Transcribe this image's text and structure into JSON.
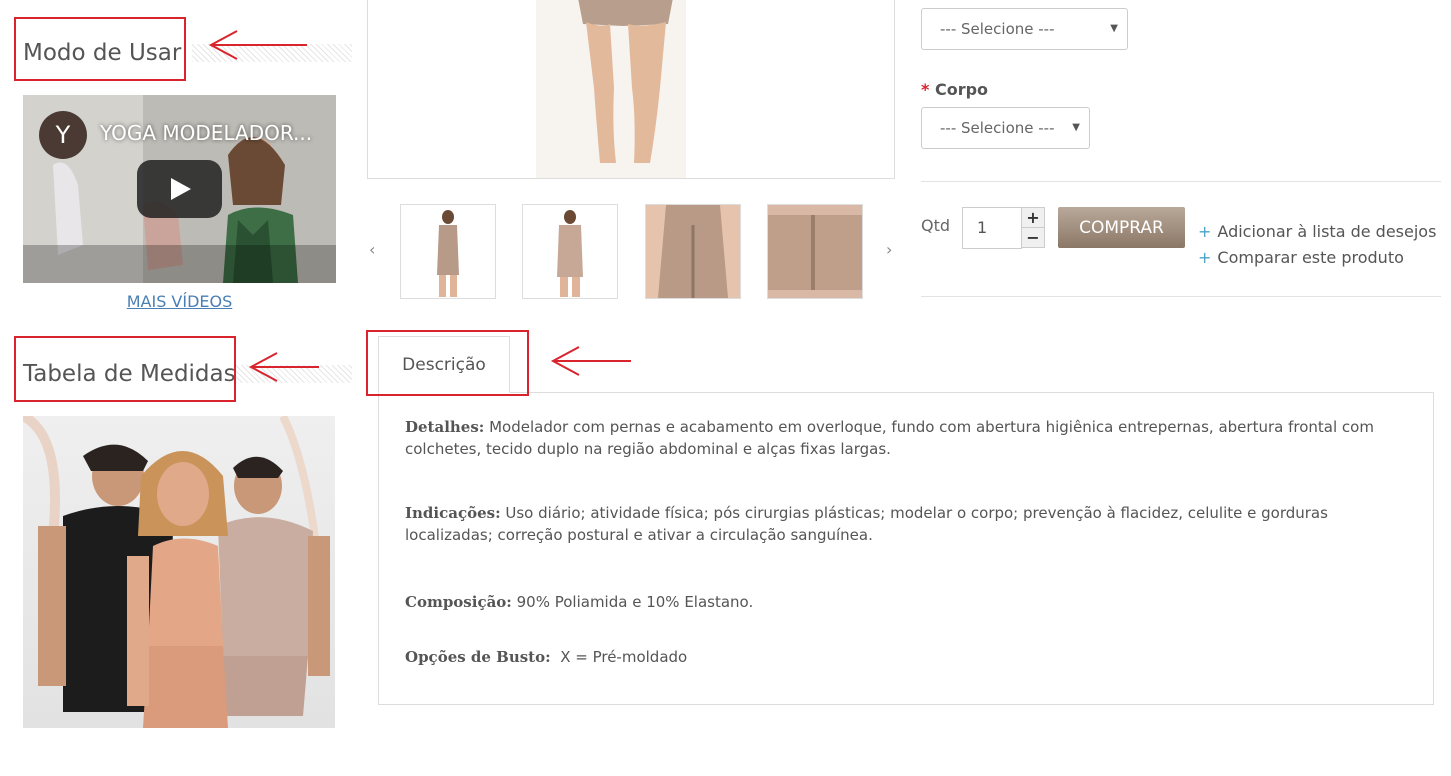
{
  "sidebar": {
    "how_to_use_title": "Modo de Usar",
    "video": {
      "channel_initial": "Y",
      "title": "YOGA MODELADOR..."
    },
    "more_videos": "MAIS VÍDEOS",
    "size_table_title": "Tabela de Medidas"
  },
  "options": {
    "first_select_value": "--- Selecione ---",
    "body_label": "Corpo",
    "required_marker": "*",
    "body_select_value": "--- Selecione ---"
  },
  "purchase": {
    "qty_label": "Qtd",
    "qty_value": "1",
    "qty_plus": "+",
    "qty_minus": "−",
    "buy_label": "COMPRAR",
    "wishlist_label": "Adicionar à lista de desejos",
    "compare_label": "Comparar este produto",
    "link_prefix": "+"
  },
  "carousel": {
    "prev": "‹",
    "next": "›"
  },
  "tabs": {
    "description_label": "Descrição"
  },
  "description": {
    "details_label": "Detalhes:",
    "details_text": " Modelador com pernas e acabamento em overloque, fundo com abertura higiênica entrepernas, abertura frontal com colchetes, tecido duplo na região abdominal e alças fixas largas.",
    "indications_label": "Indicações:",
    "indications_text": " Uso diário; atividade física; pós cirurgias plásticas; modelar o corpo; prevenção à flacidez, celulite e gorduras localizadas; correção postural e ativar a circulação sanguínea.",
    "composition_label": "Composição:",
    "composition_text": " 90% Poliamida e 10% Elastano.",
    "bust_label": "Opções de Busto:",
    "bust_text": "  X = Pré-moldado"
  },
  "colors": {
    "annotation_red": "#d9232d",
    "buy_button": "#8b7766",
    "link_plus": "#4aa3c7",
    "more_videos_link": "#4a7fb5"
  }
}
